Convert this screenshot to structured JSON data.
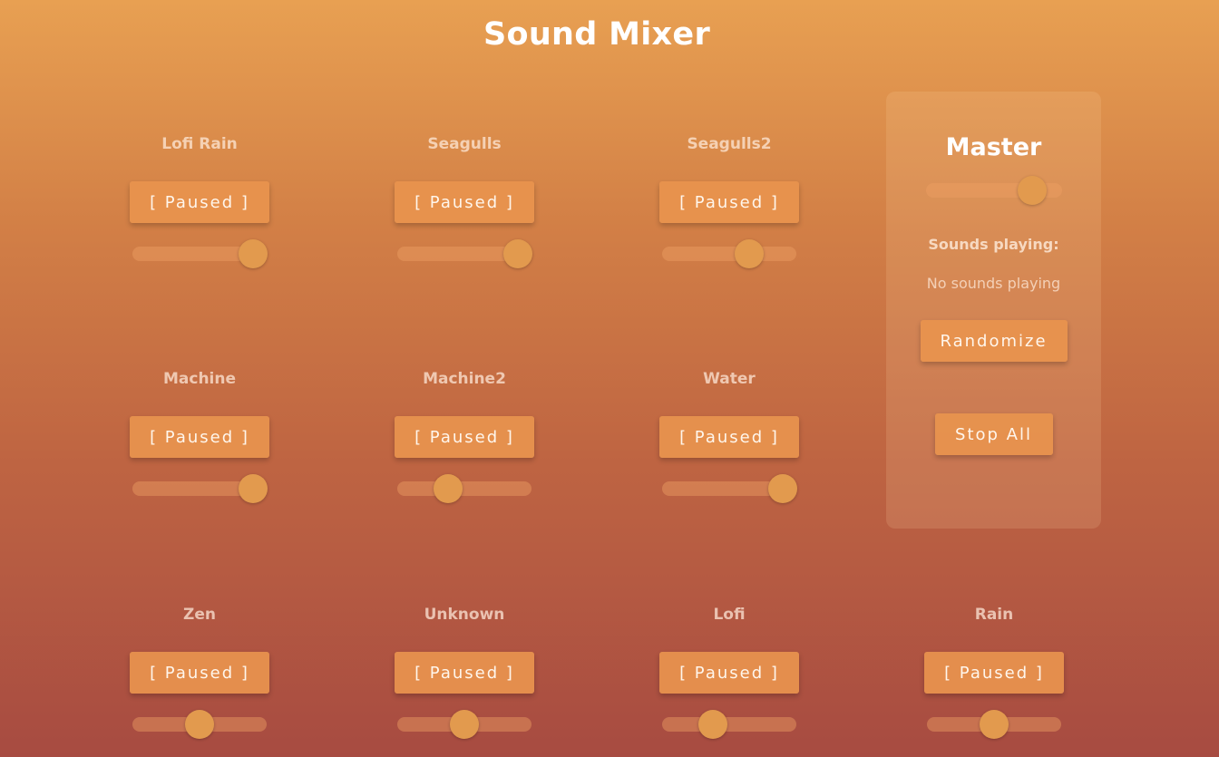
{
  "page": {
    "title": "Sound Mixer"
  },
  "channels": [
    {
      "label": "Lofi Rain",
      "button": "[ Paused ]",
      "volume": 0.9
    },
    {
      "label": "Seagulls",
      "button": "[ Paused ]",
      "volume": 0.9
    },
    {
      "label": "Seagulls2",
      "button": "[ Paused ]",
      "volume": 0.65
    },
    {
      "label": "Machine",
      "button": "[ Paused ]",
      "volume": 0.9
    },
    {
      "label": "Machine2",
      "button": "[ Paused ]",
      "volume": 0.38
    },
    {
      "label": "Water",
      "button": "[ Paused ]",
      "volume": 0.9
    },
    {
      "label": "Zen",
      "button": "[ Paused ]",
      "volume": 0.5
    },
    {
      "label": "Unknown",
      "button": "[ Paused ]",
      "volume": 0.5
    },
    {
      "label": "Lofi",
      "button": "[ Paused ]",
      "volume": 0.38
    },
    {
      "label": "Rain",
      "button": "[ Paused ]",
      "volume": 0.5
    }
  ],
  "master": {
    "title": "Master",
    "volume": 0.78,
    "sounds_playing_label": "Sounds playing:",
    "sounds_playing_value": "No sounds playing",
    "randomize_label": "Randomize",
    "stop_all_label": "Stop All"
  },
  "colors": {
    "gradient_top": "#e8a052",
    "gradient_bottom": "#a74b41",
    "button": "#e8944e",
    "slider_thumb": "#e29a4e"
  }
}
